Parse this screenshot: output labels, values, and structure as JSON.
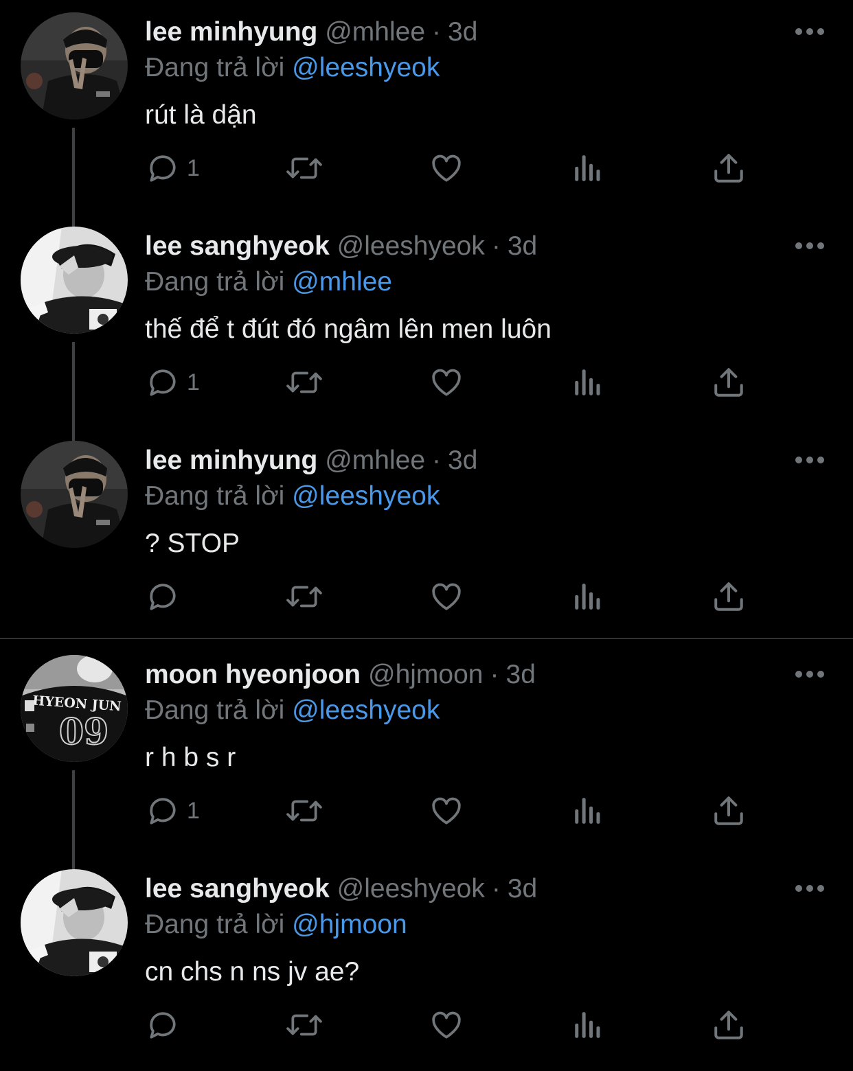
{
  "colors": {
    "background": "#000000",
    "text_primary": "#e7e9ea",
    "text_secondary": "#71767b",
    "mention": "#4a99e9",
    "thread_line": "#3e4144"
  },
  "reply_prefix": "Đang trả lời",
  "tweets": [
    {
      "name": "lee minhyung",
      "handle": "@mhlee",
      "separator": "·",
      "time": "3d",
      "reply_to": "@leeshyeok",
      "text": "rút là dận",
      "reply_count": "1",
      "avatar": "avatar-masked-peace-sign"
    },
    {
      "name": "lee sanghyeok",
      "handle": "@leeshyeok",
      "separator": "·",
      "time": "3d",
      "reply_to": "@mhlee",
      "text": "thế để t đút đó ngâm lên men luôn",
      "reply_count": "1",
      "avatar": "avatar-black-white-cap"
    },
    {
      "name": "lee minhyung",
      "handle": "@mhlee",
      "separator": "·",
      "time": "3d",
      "reply_to": "@leeshyeok",
      "text": "? STOP",
      "reply_count": "",
      "avatar": "avatar-masked-peace-sign"
    },
    {
      "name": "moon hyeonjoon",
      "handle": "@hjmoon",
      "separator": "·",
      "time": "3d",
      "reply_to": "@leeshyeok",
      "text": "r h b s r",
      "reply_count": "1",
      "avatar": "avatar-jersey-hyeon-jun-09",
      "jersey_name": "HYEON JUN",
      "jersey_number": "09"
    },
    {
      "name": "lee sanghyeok",
      "handle": "@leeshyeok",
      "separator": "·",
      "time": "3d",
      "reply_to": "@hjmoon",
      "text": "cn chs n ns jv ae?",
      "reply_count": "",
      "avatar": "avatar-black-white-cap"
    }
  ],
  "action_icons": [
    "reply-icon",
    "retweet-icon",
    "like-icon",
    "views-icon",
    "share-icon"
  ]
}
